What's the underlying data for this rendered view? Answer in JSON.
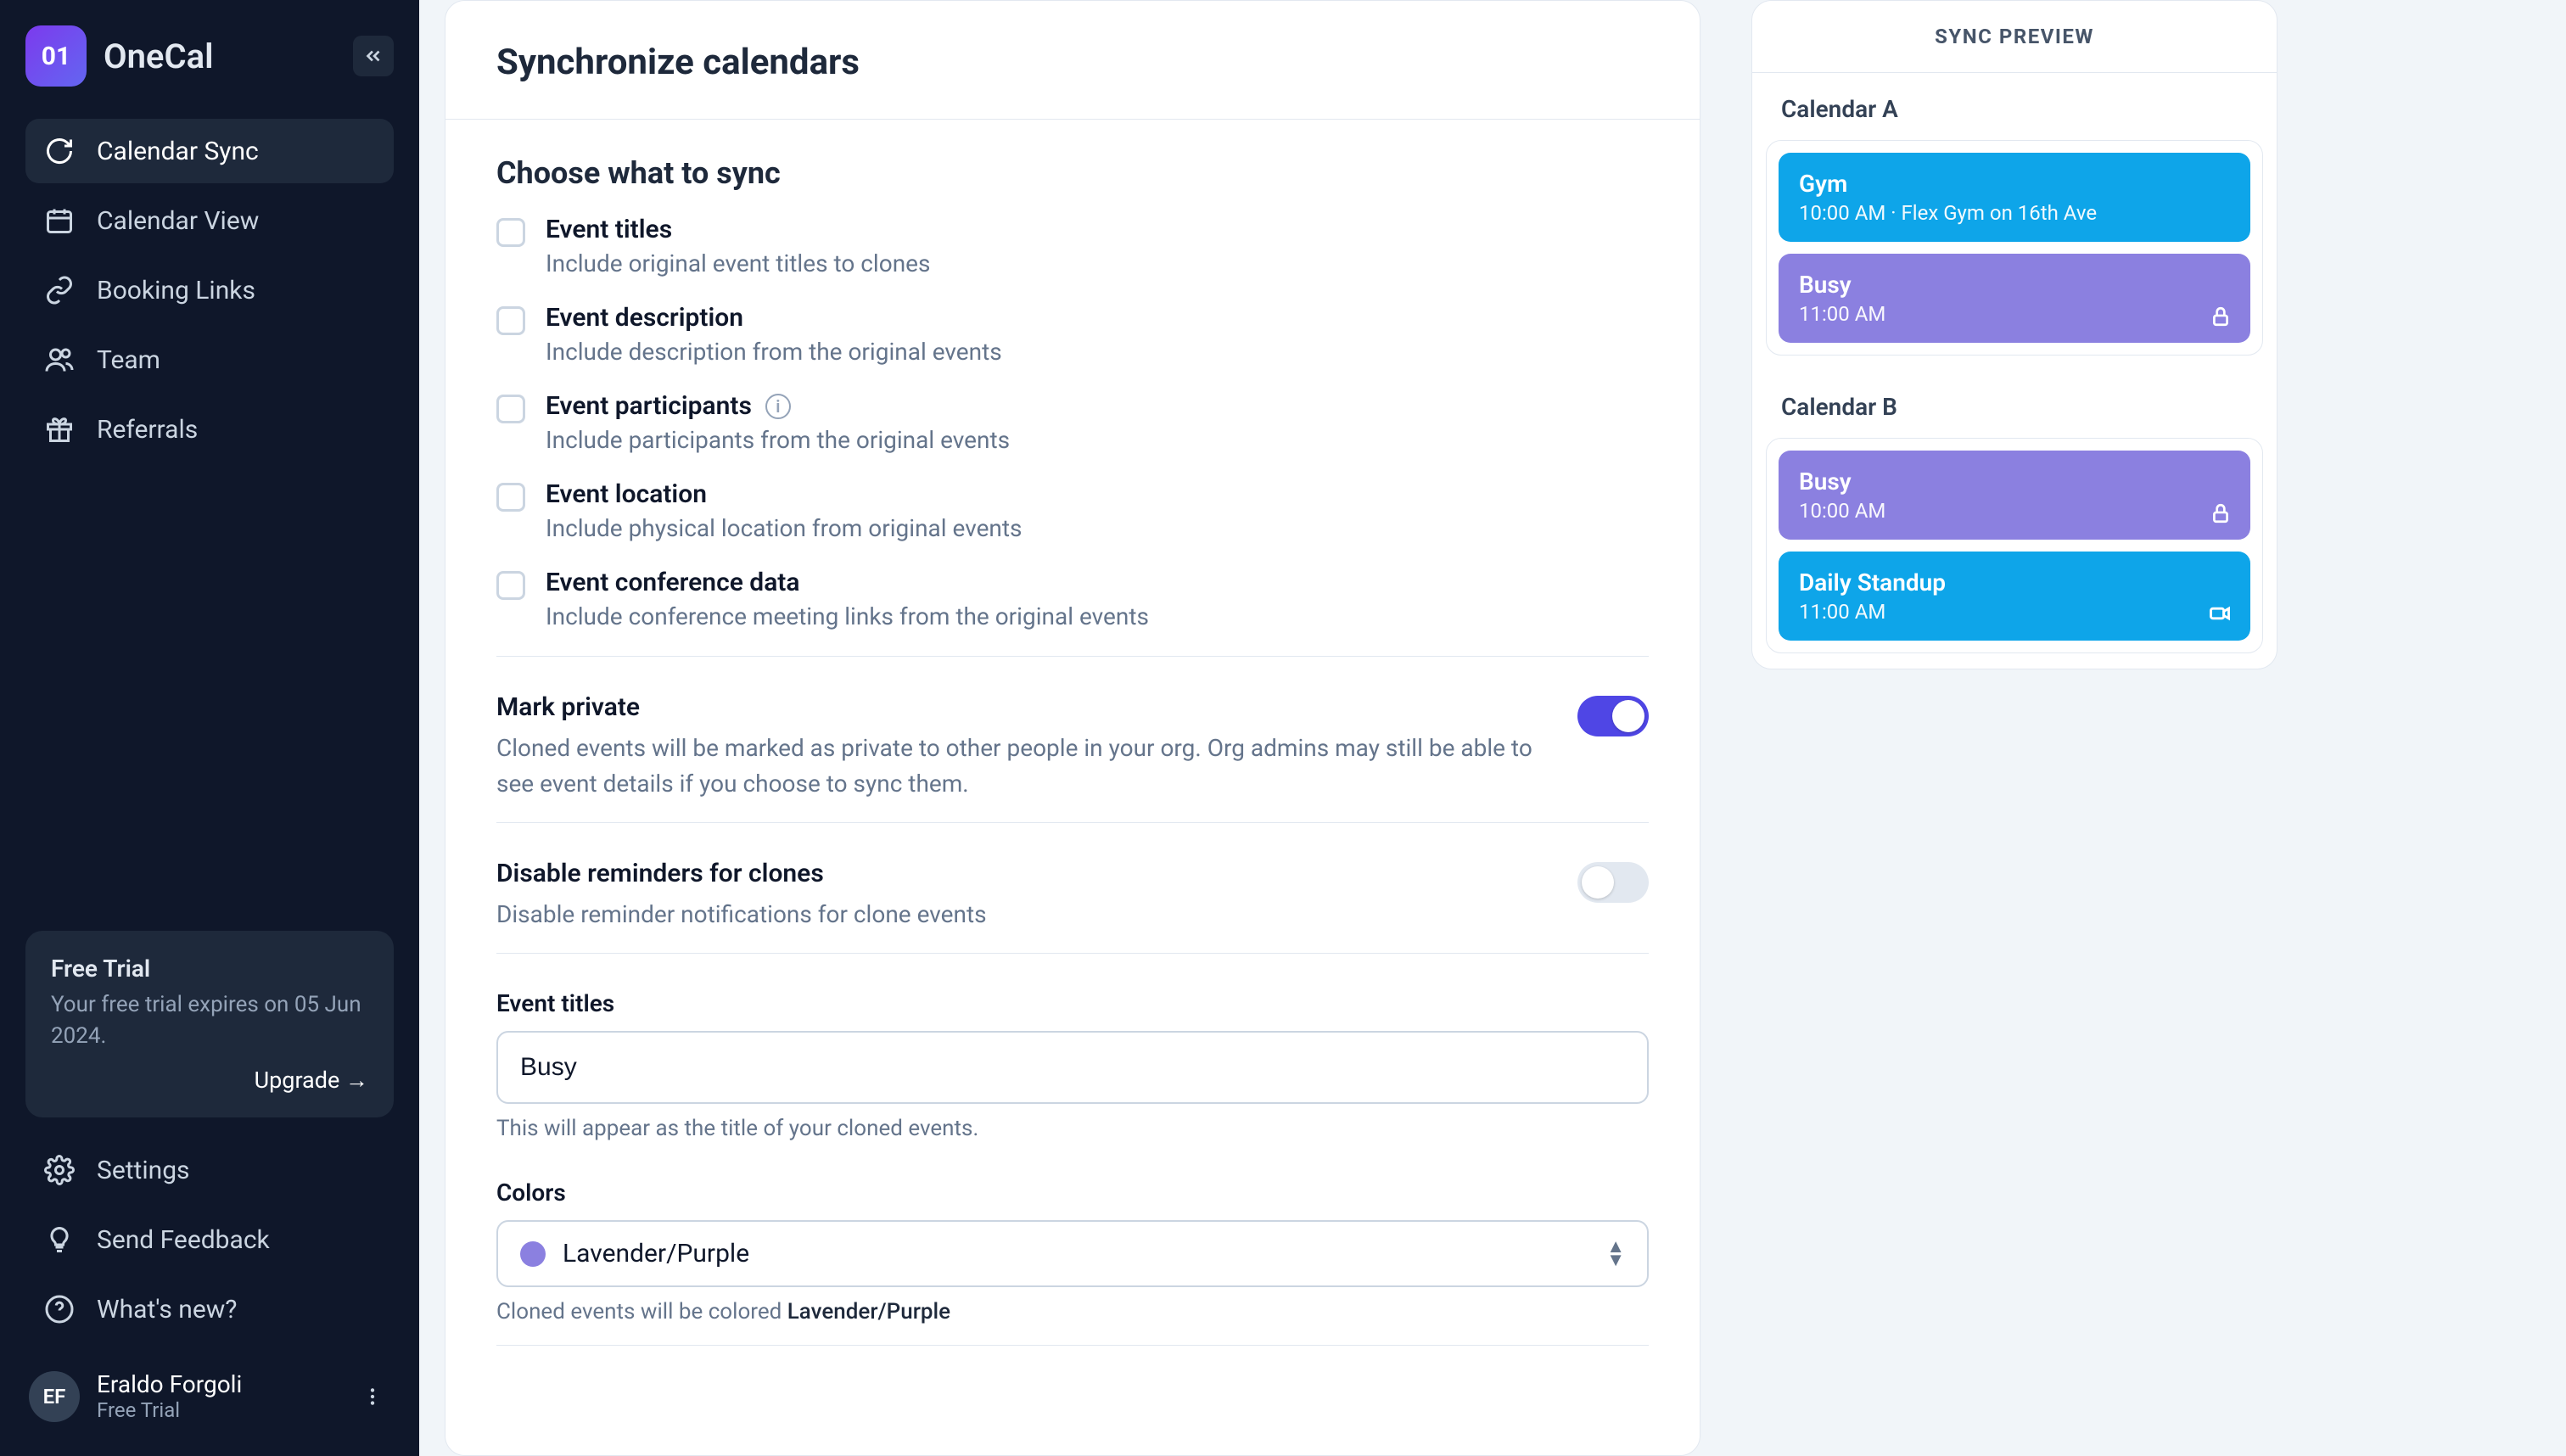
{
  "brand": {
    "logo_text": "01",
    "name": "OneCal"
  },
  "sidebar": {
    "items": [
      {
        "label": "Calendar Sync",
        "active": true
      },
      {
        "label": "Calendar View"
      },
      {
        "label": "Booking Links"
      },
      {
        "label": "Team"
      },
      {
        "label": "Referrals"
      }
    ],
    "trial": {
      "title": "Free Trial",
      "text": "Your free trial expires on 05 Jun 2024.",
      "upgrade": "Upgrade →"
    },
    "bottom": [
      {
        "label": "Settings"
      },
      {
        "label": "Send Feedback"
      },
      {
        "label": "What's new?"
      }
    ],
    "user": {
      "initials": "EF",
      "name": "Eraldo Forgoli",
      "plan": "Free Trial"
    }
  },
  "main": {
    "title": "Synchronize calendars",
    "choose_title": "Choose what to sync",
    "options": [
      {
        "label": "Event titles",
        "help": "Include original event titles to clones"
      },
      {
        "label": "Event description",
        "help": "Include description from the original events"
      },
      {
        "label": "Event participants",
        "help": "Include participants from the original events",
        "info": true
      },
      {
        "label": "Event location",
        "help": "Include physical location from original events"
      },
      {
        "label": "Event conference data",
        "help": "Include conference meeting links from the original events"
      }
    ],
    "mark_private": {
      "title": "Mark private",
      "desc": "Cloned events will be marked as private to other people in your org. Org admins may still be able to see event details if you choose to sync them.",
      "on": true
    },
    "disable_reminders": {
      "title": "Disable reminders for clones",
      "desc": "Disable reminder notifications for clone events",
      "on": false
    },
    "event_titles": {
      "label": "Event titles",
      "value": "Busy",
      "help": "This will appear as the title of your cloned events."
    },
    "colors": {
      "label": "Colors",
      "value": "Lavender/Purple",
      "help_prefix": "Cloned events will be colored ",
      "help_value": "Lavender/Purple",
      "swatch": "#8b80e0"
    }
  },
  "preview": {
    "header": "SYNC PREVIEW",
    "calendars": [
      {
        "name": "Calendar A",
        "events": [
          {
            "title": "Gym",
            "sub": "10:00 AM · Flex Gym on 16th Ave",
            "color": "blue"
          },
          {
            "title": "Busy",
            "sub": "11:00 AM",
            "color": "purple",
            "icon": "lock"
          }
        ]
      },
      {
        "name": "Calendar B",
        "events": [
          {
            "title": "Busy",
            "sub": "10:00 AM",
            "color": "purple",
            "icon": "lock"
          },
          {
            "title": "Daily Standup",
            "sub": "11:00 AM",
            "color": "blue",
            "icon": "video"
          }
        ]
      }
    ]
  }
}
